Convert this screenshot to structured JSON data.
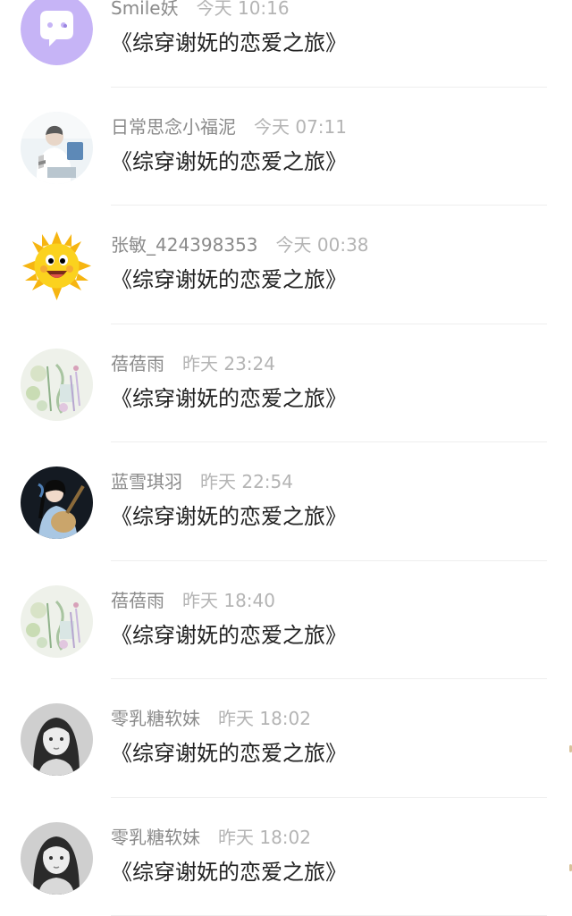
{
  "comments": [
    {
      "name": "Smile妖",
      "time": "今天 10:16",
      "message": "《综穿谢妩的恋爱之旅》",
      "avatar_icon": "purple-chat-bubble-avatar",
      "avatar_color": "#c6b4f6"
    },
    {
      "name": "日常思念小福泥",
      "time": "今天 07:11",
      "message": "《综穿谢妩的恋爱之旅》",
      "avatar_icon": "boy-reading-avatar",
      "avatar_color": "#dce7ee"
    },
    {
      "name": "张敏_424398353",
      "time": "今天 00:38",
      "message": "《综穿谢妩的恋爱之旅》",
      "avatar_icon": "smiling-sun-avatar",
      "avatar_color": "#f7c21a"
    },
    {
      "name": "蓓蓓雨",
      "time": "昨天 23:24",
      "message": "《综穿谢妩的恋爱之旅》",
      "avatar_icon": "floral-painting-avatar",
      "avatar_color": "#e6ece0"
    },
    {
      "name": "蓝雪琪羽",
      "time": "昨天 22:54",
      "message": "《综穿谢妩的恋爱之旅》",
      "avatar_icon": "pipa-girl-avatar",
      "avatar_color": "#1c2430"
    },
    {
      "name": "蓓蓓雨",
      "time": "昨天 18:40",
      "message": "《综穿谢妩的恋爱之旅》",
      "avatar_icon": "floral-painting-avatar",
      "avatar_color": "#e6ece0"
    },
    {
      "name": "零乳糖软妹",
      "time": "昨天 18:02",
      "message": "《综穿谢妩的恋爱之旅》",
      "avatar_icon": "girl-portrait-avatar",
      "avatar_color": "#b9b9b9"
    },
    {
      "name": "零乳糖软妹",
      "time": "昨天 18:02",
      "message": "《综穿谢妩的恋爱之旅》",
      "avatar_icon": "girl-portrait-avatar",
      "avatar_color": "#b9b9b9"
    }
  ],
  "colors": {
    "name_text": "#8a8a8a",
    "time_text": "#b4b4b4",
    "message_text": "#222222",
    "divider": "#eeeeee"
  }
}
